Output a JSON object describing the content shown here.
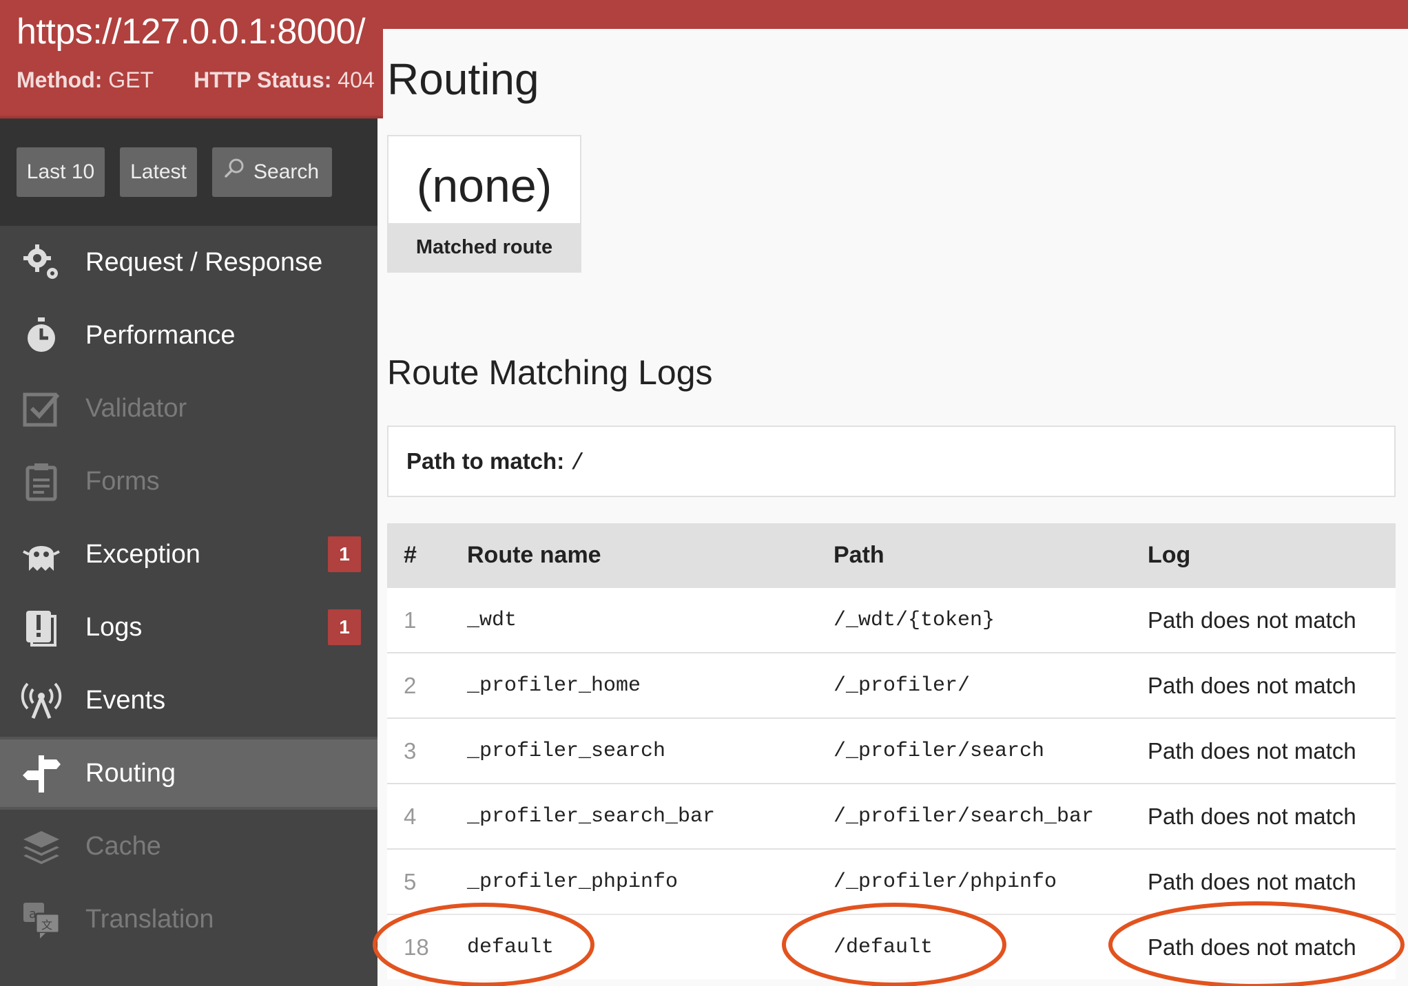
{
  "summary": {
    "url": "https://127.0.0.1:8000/",
    "method_label": "Method:",
    "method": "GET",
    "status_label": "HTTP Status:",
    "status": "404"
  },
  "toolbar": {
    "last10": "Last 10",
    "latest": "Latest",
    "search": "Search"
  },
  "menu": [
    {
      "label": "Request / Response",
      "icon": "gears-icon",
      "state": "normal"
    },
    {
      "label": "Performance",
      "icon": "stopwatch-icon",
      "state": "normal"
    },
    {
      "label": "Validator",
      "icon": "checkbox-icon",
      "state": "disabled"
    },
    {
      "label": "Forms",
      "icon": "clipboard-icon",
      "state": "disabled"
    },
    {
      "label": "Exception",
      "icon": "ghost-icon",
      "state": "normal",
      "badge": "1"
    },
    {
      "label": "Logs",
      "icon": "alert-log-icon",
      "state": "normal",
      "badge": "1"
    },
    {
      "label": "Events",
      "icon": "broadcast-icon",
      "state": "normal"
    },
    {
      "label": "Routing",
      "icon": "signpost-icon",
      "state": "active"
    },
    {
      "label": "Cache",
      "icon": "layers-icon",
      "state": "disabled"
    },
    {
      "label": "Translation",
      "icon": "translate-icon",
      "state": "disabled"
    }
  ],
  "main": {
    "title": "Routing",
    "metric_value": "(none)",
    "metric_label": "Matched route",
    "logs_title": "Route Matching Logs",
    "path_label": "Path to match:",
    "path_value": "/",
    "table": {
      "headers": [
        "#",
        "Route name",
        "Path",
        "Log"
      ],
      "rows": [
        [
          "1",
          "_wdt",
          "/_wdt/{token}",
          "Path does not match"
        ],
        [
          "2",
          "_profiler_home",
          "/_profiler/",
          "Path does not match"
        ],
        [
          "3",
          "_profiler_search",
          "/_profiler/search",
          "Path does not match"
        ],
        [
          "4",
          "_profiler_search_bar",
          "/_profiler/search_bar",
          "Path does not match"
        ],
        [
          "5",
          "_profiler_phpinfo",
          "/_profiler/phpinfo",
          "Path does not match"
        ],
        [
          "18",
          "default",
          "/default",
          "Path does not match"
        ]
      ]
    }
  },
  "colors": {
    "error_red": "#b0413e",
    "sidebar_bg": "#444444",
    "annotation_orange": "#e2531f"
  }
}
